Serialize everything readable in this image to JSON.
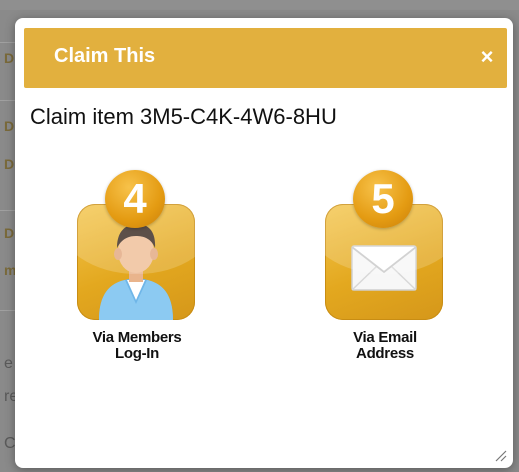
{
  "background": {
    "letters": [
      "D",
      "D",
      "D",
      "D",
      "m",
      "e",
      "re",
      "C"
    ]
  },
  "dialog": {
    "title": "Claim This",
    "close_symbol": "×",
    "heading": "Claim item 3M5-C4K-4W6-8HU",
    "options": [
      {
        "badge": "4",
        "label_line1": "Via Members",
        "label_line2": "Log-In",
        "icon": "user-icon"
      },
      {
        "badge": "5",
        "label_line1": "Via Email",
        "label_line2": "Address",
        "icon": "envelope-icon"
      }
    ]
  },
  "colors": {
    "accent": "#e2b03e",
    "tile": "#e3a81f",
    "badge": "#e49b12"
  }
}
